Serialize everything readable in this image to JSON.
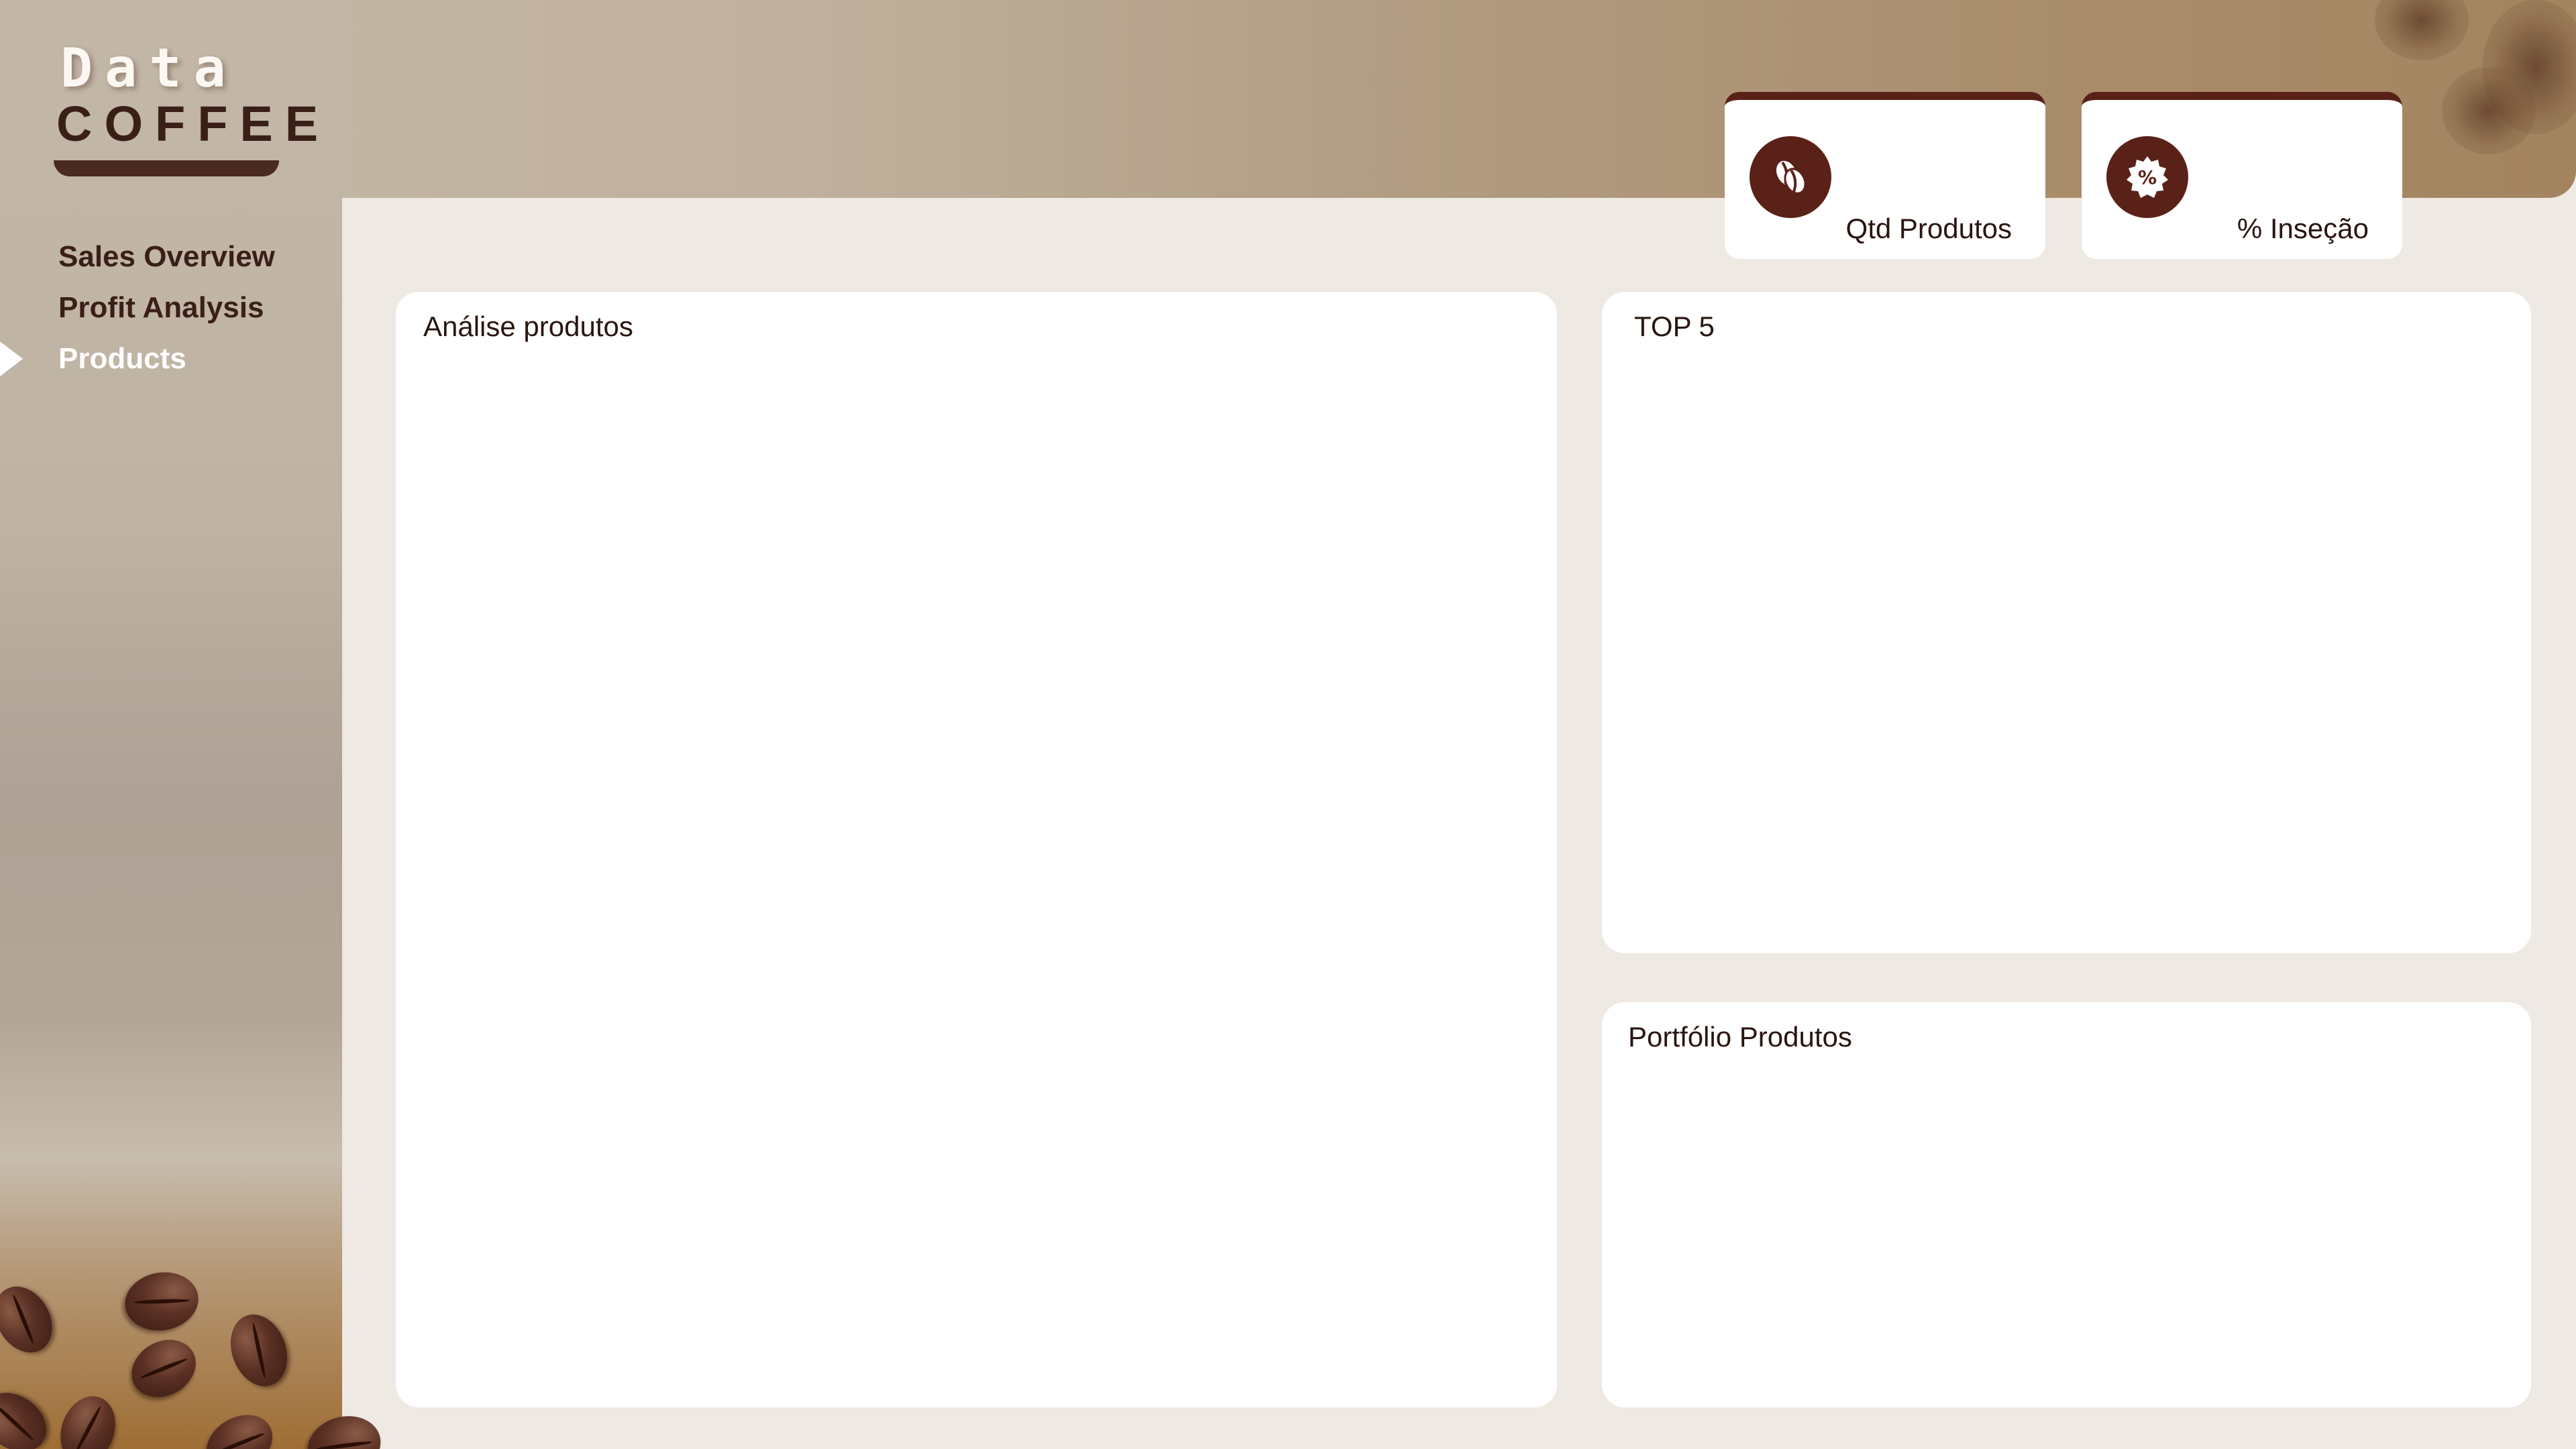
{
  "app": {
    "logo_line1": "Data",
    "logo_line2": "COFFEE"
  },
  "nav": {
    "items": [
      {
        "label": "Sales Overview",
        "active": false
      },
      {
        "label": "Profit Analysis",
        "active": false
      },
      {
        "label": "Products",
        "active": true
      }
    ]
  },
  "kpis": [
    {
      "label": "Qtd Produtos",
      "icon": "coffee-bean-icon"
    },
    {
      "label": "% Inseção",
      "icon": "percent-badge-icon"
    }
  ],
  "cards": {
    "analysis_title": "Análise produtos",
    "top5_title": "TOP 5",
    "portfolio_title": "Portfólio Produtos"
  },
  "colors": {
    "accent_dark": "#5a2118",
    "text_dark": "#3a1f18",
    "panel_bg": "#efe9e3",
    "card_bg": "#ffffff"
  }
}
